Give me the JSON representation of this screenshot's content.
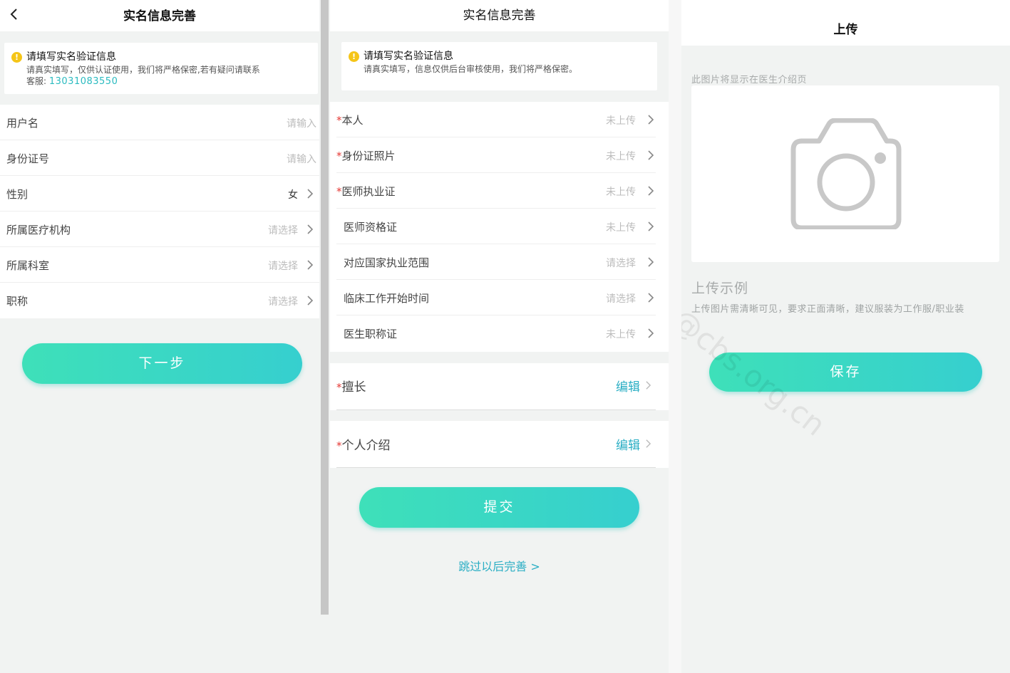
{
  "panel1": {
    "header_title": "实名信息完善",
    "notice_title": "请填写实名验证信息",
    "notice_desc_line1": "请真实填写，仅供认证使用，我们将严格保密,若有疑问请联系",
    "notice_desc_prefix": "客服: ",
    "notice_phone": "13031083550",
    "rows": [
      {
        "label": "用户名",
        "value": "请输入"
      },
      {
        "label": "身份证号",
        "value": "请输入"
      },
      {
        "label": "性别",
        "value": "女"
      },
      {
        "label": "所属医疗机构",
        "value": "请选择"
      },
      {
        "label": "所属科室",
        "value": "请选择"
      },
      {
        "label": "职称",
        "value": "请选择"
      }
    ],
    "next_button": "下一步"
  },
  "panel2": {
    "header_title": "实名信息完善",
    "notice_title": "请填写实名验证信息",
    "notice_desc": "请真实填写，信息仅供后台审核使用，我们将严格保密。",
    "required_mark": "*",
    "rows": [
      {
        "label": "本人",
        "value": "未上传"
      },
      {
        "label": "身份证照片",
        "value": "未上传"
      },
      {
        "label": "医师执业证",
        "value": "未上传"
      },
      {
        "label": "医师资格证",
        "value": "未上传"
      },
      {
        "label": "对应国家执业范围",
        "value": "请选择"
      },
      {
        "label": "临床工作开始时间",
        "value": "请选择"
      },
      {
        "label": "医生职称证",
        "value": "未上传"
      }
    ],
    "specialty_label": "擅长",
    "intro_label": "个人介绍",
    "edit_label": "编辑",
    "submit_button": "提交",
    "skip_link": "跳过以后完善 >"
  },
  "panel3": {
    "header_title": "上传",
    "hint": "此图片将显示在医生介绍页",
    "example_title": "上传示例",
    "example_desc": "上传图片需清晰可见，要求正面清晰，建议服装为工作服/职业装",
    "save_button": "保存",
    "watermark": "z@cbs.org.cn",
    "camera_icon": "camera-icon"
  },
  "colors": {
    "accent": "#2aaec4",
    "button_start": "#3ee0b9",
    "button_end": "#36cfcf",
    "required": "#e53935",
    "warning": "#f5c518"
  }
}
